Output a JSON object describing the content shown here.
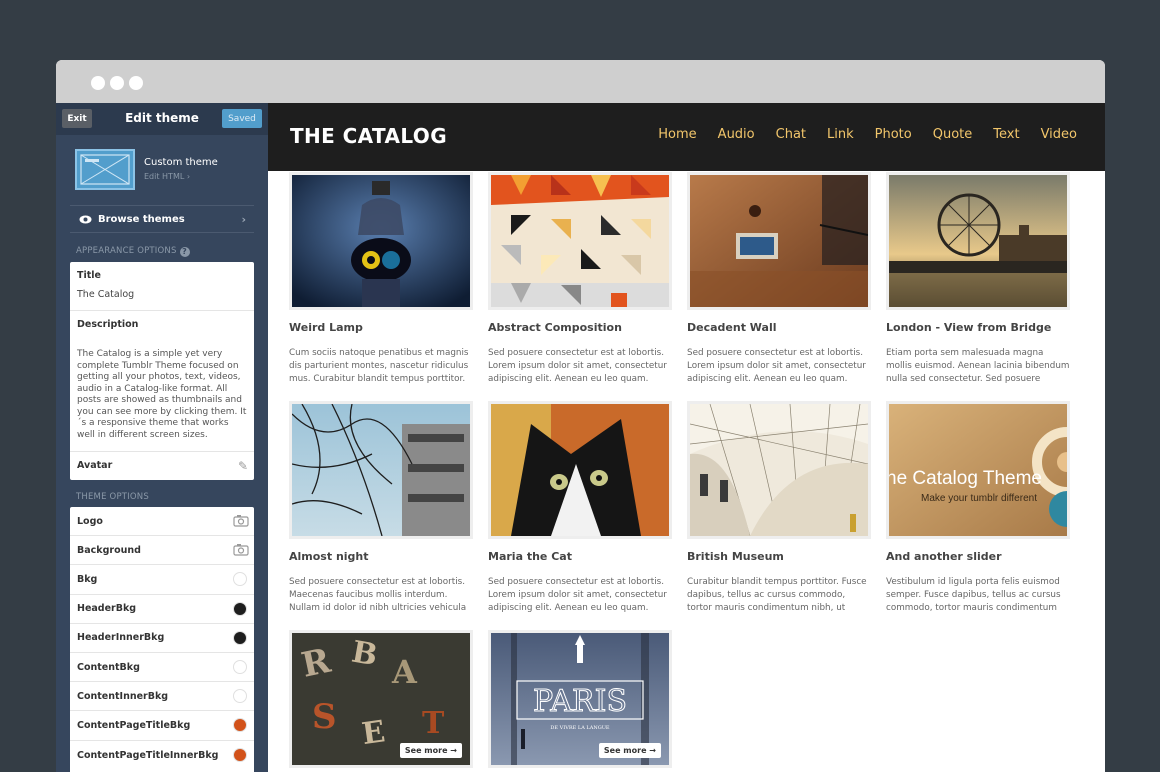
{
  "editor": {
    "exit_label": "Exit",
    "title": "Edit theme",
    "saved_label": "Saved",
    "custom_theme_name": "Custom theme",
    "edit_html_label": "Edit HTML ›",
    "browse_label": "Browse themes",
    "appearance_label": "APPEARANCE OPTIONS",
    "theme_options_label": "THEME OPTIONS"
  },
  "appearance": {
    "title_label": "Title",
    "title_value": "The Catalog",
    "description_label": "Description",
    "description_value": "The Catalog is a simple yet very complete Tumblr Theme focused on getting all your photos, text, videos, audio in a Catalog-like format. All posts are showed as thumbnails and you can see more by clicking them. It´s a responsive theme that works well in different screen sizes.",
    "avatar_label": "Avatar"
  },
  "theme_options": [
    {
      "label": "Logo",
      "kind": "image"
    },
    {
      "label": "Background",
      "kind": "image"
    },
    {
      "label": "Bkg",
      "kind": "color",
      "color": "#ffffff"
    },
    {
      "label": "HeaderBkg",
      "kind": "color",
      "color": "#1e1e1e"
    },
    {
      "label": "HeaderInnerBkg",
      "kind": "color",
      "color": "#1e1e1e"
    },
    {
      "label": "ContentBkg",
      "kind": "color",
      "color": "#ffffff"
    },
    {
      "label": "ContentInnerBkg",
      "kind": "color",
      "color": "#ffffff"
    },
    {
      "label": "ContentPageTitleBkg",
      "kind": "color",
      "color": "#d2521a"
    },
    {
      "label": "ContentPageTitleInnerBkg",
      "kind": "color",
      "color": "#d2521a"
    }
  ],
  "site": {
    "title": "THE CATALOG",
    "nav": [
      "Home",
      "Audio",
      "Chat",
      "Link",
      "Photo",
      "Quote",
      "Text",
      "Video"
    ],
    "accent": "#f2c66b"
  },
  "posts": [
    {
      "title": "Weird Lamp",
      "text": "Cum sociis natoque penatibus et magnis dis parturient montes, nascetur ridiculus mus. Curabitur blandit tempus porttitor."
    },
    {
      "title": "Abstract Composition",
      "text": "Sed posuere consectetur est at lobortis. Lorem ipsum dolor sit amet, consectetur adipiscing elit. Aenean eu leo quam."
    },
    {
      "title": "Decadent Wall",
      "text": "Sed posuere consectetur est at lobortis. Lorem ipsum dolor sit amet, consectetur adipiscing elit. Aenean eu leo quam."
    },
    {
      "title": "London - View from Bridge",
      "text": "Etiam porta sem malesuada magna mollis euismod. Aenean lacinia bibendum nulla sed consectetur.  Sed posuere consectetur est at"
    },
    {
      "title": "Almost night",
      "text": "Sed posuere consectetur est at lobortis. Maecenas faucibus mollis interdum. Nullam id dolor id nibh ultricies vehicula"
    },
    {
      "title": "Maria the Cat",
      "text": "Sed posuere consectetur est at lobortis. Lorem ipsum dolor sit amet, consectetur adipiscing elit. Aenean eu leo quam."
    },
    {
      "title": "British Museum",
      "text": "Curabitur blandit tempus porttitor. Fusce dapibus, tellus ac cursus commodo, tortor mauris condimentum nibh, ut fermentum"
    },
    {
      "title": "And another slider",
      "text": "Vestibulum id ligula porta felis euismod semper. Fusce dapibus, tellus ac cursus commodo, tortor mauris condimentum nibh,"
    },
    {
      "see_more": "See more →"
    },
    {
      "see_more": "See more →"
    }
  ],
  "slider_text": {
    "heading": "he Catalog Theme",
    "sub": "Make your tumblr different"
  },
  "paris_text": {
    "word": "PARIS",
    "tagline": "DE VIVRE LA LANGUE"
  }
}
